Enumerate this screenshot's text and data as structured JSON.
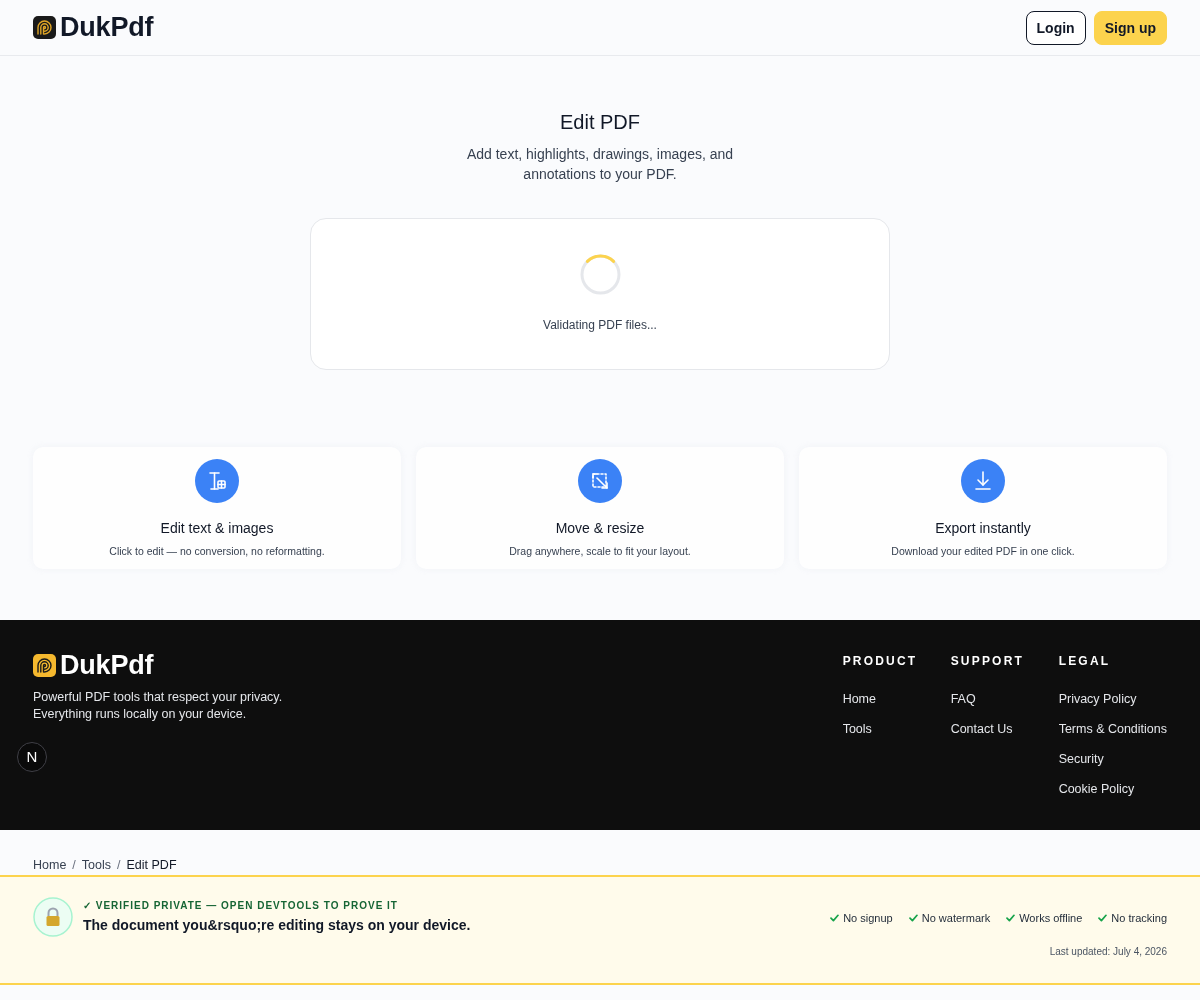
{
  "header": {
    "logo_text": "DukPdf",
    "buttons": [
      {
        "label": "Login",
        "kind": "outline"
      },
      {
        "label": "Sign up",
        "kind": "primary"
      }
    ]
  },
  "hero": {
    "title": "Edit PDF",
    "subtitle": "Add text, highlights, drawings, images, and annotations to your PDF."
  },
  "upload_card": {
    "status": "Validating PDF files..."
  },
  "features": [
    {
      "kind": "edit",
      "title": "Edit text & images",
      "description": "Click to edit — no conversion, no reformatting."
    },
    {
      "kind": "move",
      "title": "Move & resize",
      "description": "Drag anywhere, scale to fit your layout."
    },
    {
      "kind": "export",
      "title": "Export instantly",
      "description": "Download your edited PDF in one click."
    }
  ],
  "footer": {
    "logo_text": "DukPdf",
    "tagline": "Powerful PDF tools that respect your privacy. Everything runs locally on your device.",
    "columns": [
      {
        "heading": "PRODUCT",
        "links": [
          "Home",
          "Tools"
        ]
      },
      {
        "heading": "SUPPORT",
        "links": [
          "FAQ",
          "Contact Us"
        ]
      },
      {
        "heading": "LEGAL",
        "links": [
          "Privacy Policy",
          "Terms & Conditions",
          "Security",
          "Cookie Policy"
        ]
      }
    ]
  },
  "dev_badge": {
    "label": "N"
  },
  "breadcrumb": [
    {
      "kind": "link",
      "label": "Home"
    },
    {
      "kind": "separator",
      "label": "/"
    },
    {
      "kind": "link",
      "label": "Tools"
    },
    {
      "kind": "separator",
      "label": "/"
    },
    {
      "kind": "current",
      "label": "Edit PDF"
    }
  ],
  "privacy_banner": {
    "eyebrow": "✓ VERIFIED PRIVATE — OPEN DEVTOOLS TO PROVE IT",
    "message": "The document you&rsquo;re editing stays on your device.",
    "badges": [
      "No signup",
      "No watermark",
      "Works offline",
      "No tracking"
    ],
    "last_updated": "Last updated: July 4, 2026"
  }
}
